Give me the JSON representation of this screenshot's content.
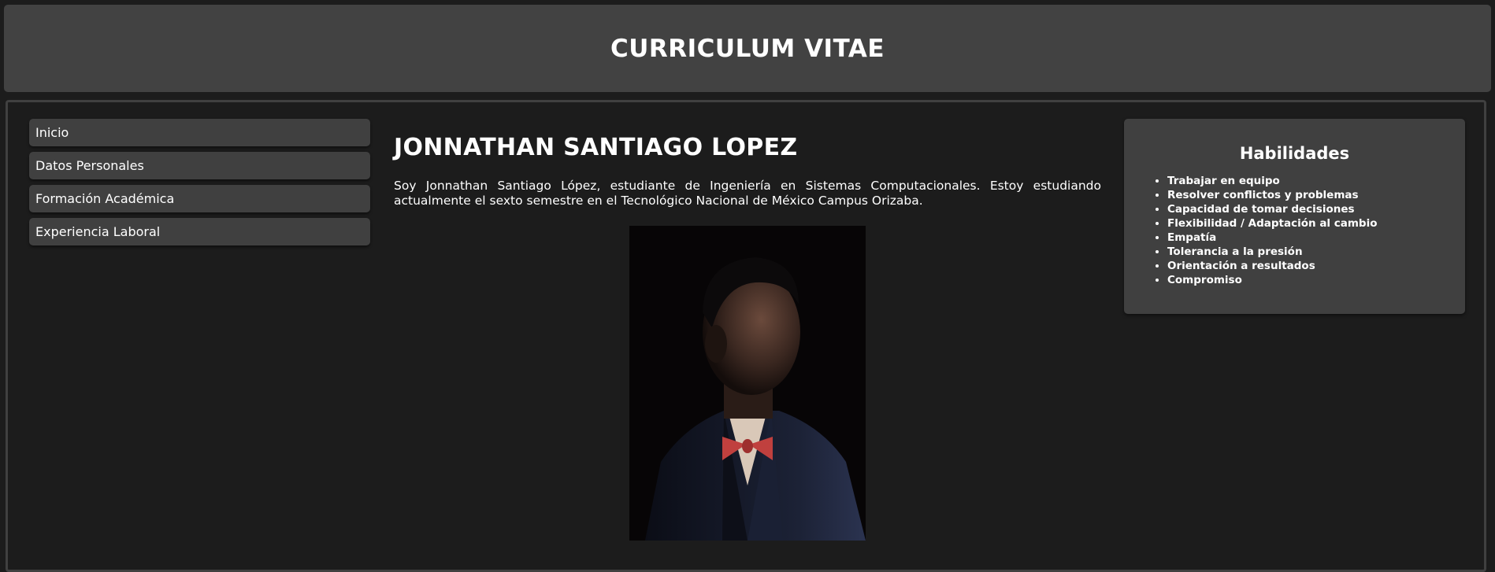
{
  "header": {
    "title": "CURRICULUM VITAE"
  },
  "sidebar": {
    "items": [
      {
        "label": "Inicio"
      },
      {
        "label": "Datos Personales"
      },
      {
        "label": "Formación Académica"
      },
      {
        "label": "Experiencia Laboral"
      }
    ]
  },
  "main": {
    "name": "JONNATHAN SANTIAGO LOPEZ",
    "intro": "Soy Jonnathan Santiago López, estudiante de Ingeniería en Sistemas Computacionales. Estoy estudiando actualmente el sexto semestre en el Tecnológico Nacional de México Campus Orizaba.",
    "photo_icon": "portrait-photo"
  },
  "skills": {
    "title": "Habilidades",
    "items": [
      "Trabajar en equipo",
      "Resolver conflictos y problemas",
      "Capacidad de tomar decisiones",
      "Flexibilidad / Adaptación al cambio",
      "Empatía",
      "Tolerancia a la presión",
      "Orientación a resultados",
      "Compromiso"
    ]
  },
  "colors": {
    "background": "#1c1c1c",
    "panel": "#424242",
    "text": "#ffffff"
  }
}
